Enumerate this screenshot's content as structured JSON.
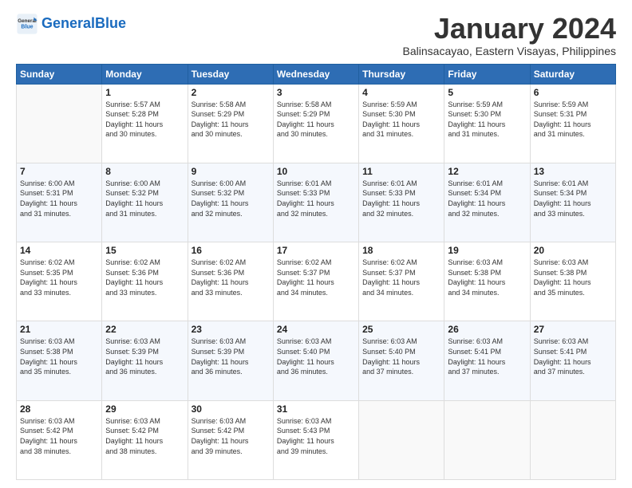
{
  "logo": {
    "general": "General",
    "blue": "Blue"
  },
  "header": {
    "month": "January 2024",
    "location": "Balinsacayao, Eastern Visayas, Philippines"
  },
  "weekdays": [
    "Sunday",
    "Monday",
    "Tuesday",
    "Wednesday",
    "Thursday",
    "Friday",
    "Saturday"
  ],
  "weeks": [
    [
      {
        "day": "",
        "info": ""
      },
      {
        "day": "1",
        "info": "Sunrise: 5:57 AM\nSunset: 5:28 PM\nDaylight: 11 hours\nand 30 minutes."
      },
      {
        "day": "2",
        "info": "Sunrise: 5:58 AM\nSunset: 5:29 PM\nDaylight: 11 hours\nand 30 minutes."
      },
      {
        "day": "3",
        "info": "Sunrise: 5:58 AM\nSunset: 5:29 PM\nDaylight: 11 hours\nand 30 minutes."
      },
      {
        "day": "4",
        "info": "Sunrise: 5:59 AM\nSunset: 5:30 PM\nDaylight: 11 hours\nand 31 minutes."
      },
      {
        "day": "5",
        "info": "Sunrise: 5:59 AM\nSunset: 5:30 PM\nDaylight: 11 hours\nand 31 minutes."
      },
      {
        "day": "6",
        "info": "Sunrise: 5:59 AM\nSunset: 5:31 PM\nDaylight: 11 hours\nand 31 minutes."
      }
    ],
    [
      {
        "day": "7",
        "info": "Sunrise: 6:00 AM\nSunset: 5:31 PM\nDaylight: 11 hours\nand 31 minutes."
      },
      {
        "day": "8",
        "info": "Sunrise: 6:00 AM\nSunset: 5:32 PM\nDaylight: 11 hours\nand 31 minutes."
      },
      {
        "day": "9",
        "info": "Sunrise: 6:00 AM\nSunset: 5:32 PM\nDaylight: 11 hours\nand 32 minutes."
      },
      {
        "day": "10",
        "info": "Sunrise: 6:01 AM\nSunset: 5:33 PM\nDaylight: 11 hours\nand 32 minutes."
      },
      {
        "day": "11",
        "info": "Sunrise: 6:01 AM\nSunset: 5:33 PM\nDaylight: 11 hours\nand 32 minutes."
      },
      {
        "day": "12",
        "info": "Sunrise: 6:01 AM\nSunset: 5:34 PM\nDaylight: 11 hours\nand 32 minutes."
      },
      {
        "day": "13",
        "info": "Sunrise: 6:01 AM\nSunset: 5:34 PM\nDaylight: 11 hours\nand 33 minutes."
      }
    ],
    [
      {
        "day": "14",
        "info": "Sunrise: 6:02 AM\nSunset: 5:35 PM\nDaylight: 11 hours\nand 33 minutes."
      },
      {
        "day": "15",
        "info": "Sunrise: 6:02 AM\nSunset: 5:36 PM\nDaylight: 11 hours\nand 33 minutes."
      },
      {
        "day": "16",
        "info": "Sunrise: 6:02 AM\nSunset: 5:36 PM\nDaylight: 11 hours\nand 33 minutes."
      },
      {
        "day": "17",
        "info": "Sunrise: 6:02 AM\nSunset: 5:37 PM\nDaylight: 11 hours\nand 34 minutes."
      },
      {
        "day": "18",
        "info": "Sunrise: 6:02 AM\nSunset: 5:37 PM\nDaylight: 11 hours\nand 34 minutes."
      },
      {
        "day": "19",
        "info": "Sunrise: 6:03 AM\nSunset: 5:38 PM\nDaylight: 11 hours\nand 34 minutes."
      },
      {
        "day": "20",
        "info": "Sunrise: 6:03 AM\nSunset: 5:38 PM\nDaylight: 11 hours\nand 35 minutes."
      }
    ],
    [
      {
        "day": "21",
        "info": "Sunrise: 6:03 AM\nSunset: 5:38 PM\nDaylight: 11 hours\nand 35 minutes."
      },
      {
        "day": "22",
        "info": "Sunrise: 6:03 AM\nSunset: 5:39 PM\nDaylight: 11 hours\nand 36 minutes."
      },
      {
        "day": "23",
        "info": "Sunrise: 6:03 AM\nSunset: 5:39 PM\nDaylight: 11 hours\nand 36 minutes."
      },
      {
        "day": "24",
        "info": "Sunrise: 6:03 AM\nSunset: 5:40 PM\nDaylight: 11 hours\nand 36 minutes."
      },
      {
        "day": "25",
        "info": "Sunrise: 6:03 AM\nSunset: 5:40 PM\nDaylight: 11 hours\nand 37 minutes."
      },
      {
        "day": "26",
        "info": "Sunrise: 6:03 AM\nSunset: 5:41 PM\nDaylight: 11 hours\nand 37 minutes."
      },
      {
        "day": "27",
        "info": "Sunrise: 6:03 AM\nSunset: 5:41 PM\nDaylight: 11 hours\nand 37 minutes."
      }
    ],
    [
      {
        "day": "28",
        "info": "Sunrise: 6:03 AM\nSunset: 5:42 PM\nDaylight: 11 hours\nand 38 minutes."
      },
      {
        "day": "29",
        "info": "Sunrise: 6:03 AM\nSunset: 5:42 PM\nDaylight: 11 hours\nand 38 minutes."
      },
      {
        "day": "30",
        "info": "Sunrise: 6:03 AM\nSunset: 5:42 PM\nDaylight: 11 hours\nand 39 minutes."
      },
      {
        "day": "31",
        "info": "Sunrise: 6:03 AM\nSunset: 5:43 PM\nDaylight: 11 hours\nand 39 minutes."
      },
      {
        "day": "",
        "info": ""
      },
      {
        "day": "",
        "info": ""
      },
      {
        "day": "",
        "info": ""
      }
    ]
  ]
}
